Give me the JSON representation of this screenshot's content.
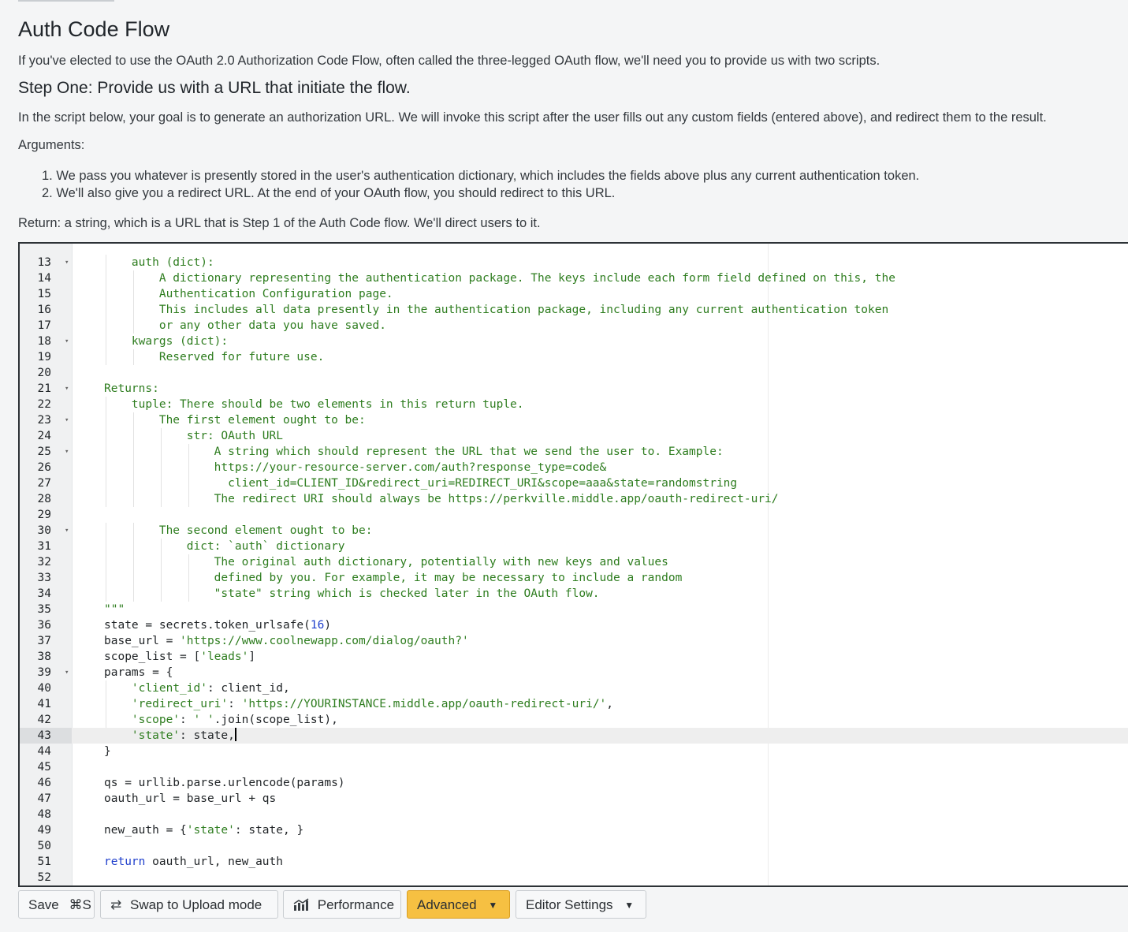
{
  "page": {
    "title": "Auth Code Flow",
    "intro": "If you've elected to use the OAuth 2.0 Authorization Code Flow, often called the three-legged OAuth flow, we'll need you to provide us with two scripts.",
    "step_heading": "Step One: Provide us with a URL that initiate the flow.",
    "step_desc": "In the script below, your goal is to generate an authorization URL. We will invoke this script after the user fills out any custom fields (entered above), and redirect them to the result.",
    "args_label": "Arguments:",
    "args": [
      "1. We pass you whatever is presently stored in the user's authentication dictionary, which includes the fields above plus any current authentication token.",
      "2. We'll also give you a redirect URL. At the end of your OAuth flow, you should redirect to this URL."
    ],
    "return_text": "Return: a string, which is a URL that is Step 1 of the Auth Code flow. We'll direct users to it."
  },
  "editor": {
    "lines": [
      {
        "n": "13",
        "fold": true,
        "text": "    auth (dict):",
        "kind": "doc"
      },
      {
        "n": "14",
        "fold": false,
        "text": "        A dictionary representing the authentication package. The keys include each form field defined on this, the",
        "kind": "doc"
      },
      {
        "n": "15",
        "fold": false,
        "text": "        Authentication Configuration page.",
        "kind": "doc"
      },
      {
        "n": "16",
        "fold": false,
        "text": "        This includes all data presently in the authentication package, including any current authentication token",
        "kind": "doc"
      },
      {
        "n": "17",
        "fold": false,
        "text": "        or any other data you have saved.",
        "kind": "doc"
      },
      {
        "n": "18",
        "fold": true,
        "text": "    kwargs (dict):",
        "kind": "doc"
      },
      {
        "n": "19",
        "fold": false,
        "text": "        Reserved for future use.",
        "kind": "doc"
      },
      {
        "n": "20",
        "fold": false,
        "text": "",
        "kind": "doc"
      },
      {
        "n": "21",
        "fold": true,
        "text": "Returns:",
        "kind": "doc"
      },
      {
        "n": "22",
        "fold": false,
        "text": "    tuple: There should be two elements in this return tuple.",
        "kind": "doc"
      },
      {
        "n": "23",
        "fold": true,
        "text": "        The first element ought to be:",
        "kind": "doc"
      },
      {
        "n": "24",
        "fold": false,
        "text": "            str: OAuth URL",
        "kind": "doc"
      },
      {
        "n": "25",
        "fold": true,
        "text": "                A string which should represent the URL that we send the user to. Example:",
        "kind": "doc"
      },
      {
        "n": "26",
        "fold": false,
        "text": "                https://your-resource-server.com/auth?response_type=code&",
        "kind": "doc"
      },
      {
        "n": "27",
        "fold": false,
        "text": "                  client_id=CLIENT_ID&redirect_uri=REDIRECT_URI&scope=aaa&state=randomstring",
        "kind": "doc"
      },
      {
        "n": "28",
        "fold": false,
        "text": "                The redirect URI should always be https://perkville.middle.app/oauth-redirect-uri/",
        "kind": "doc"
      },
      {
        "n": "29",
        "fold": false,
        "text": "",
        "kind": "doc"
      },
      {
        "n": "30",
        "fold": true,
        "text": "        The second element ought to be:",
        "kind": "doc"
      },
      {
        "n": "31",
        "fold": false,
        "text": "            dict: `auth` dictionary",
        "kind": "doc"
      },
      {
        "n": "32",
        "fold": false,
        "text": "                The original auth dictionary, potentially with new keys and values",
        "kind": "doc"
      },
      {
        "n": "33",
        "fold": false,
        "text": "                defined by you. For example, it may be necessary to include a random",
        "kind": "doc"
      },
      {
        "n": "34",
        "fold": false,
        "text": "                \"state\" string which is checked later in the OAuth flow.",
        "kind": "doc"
      },
      {
        "n": "35",
        "fold": false,
        "text": "\"\"\"",
        "kind": "doc"
      },
      {
        "n": "36",
        "fold": false,
        "text": "state = secrets.token_urlsafe(16)",
        "kind": "code"
      },
      {
        "n": "37",
        "fold": false,
        "text": "base_url = 'https://www.coolnewapp.com/dialog/oauth?'",
        "kind": "code"
      },
      {
        "n": "38",
        "fold": false,
        "text": "scope_list = ['leads']",
        "kind": "code"
      },
      {
        "n": "39",
        "fold": true,
        "text": "params = {",
        "kind": "code"
      },
      {
        "n": "40",
        "fold": false,
        "text": "    'client_id': client_id,",
        "kind": "code"
      },
      {
        "n": "41",
        "fold": false,
        "text": "    'redirect_uri': 'https://YOURINSTANCE.middle.app/oauth-redirect-uri/',",
        "kind": "code"
      },
      {
        "n": "42",
        "fold": false,
        "text": "    'scope': ' '.join(scope_list),",
        "kind": "code"
      },
      {
        "n": "43",
        "fold": false,
        "text": "    'state': state,",
        "kind": "code",
        "active": true
      },
      {
        "n": "44",
        "fold": false,
        "text": "}",
        "kind": "code"
      },
      {
        "n": "45",
        "fold": false,
        "text": "",
        "kind": "code"
      },
      {
        "n": "46",
        "fold": false,
        "text": "qs = urllib.parse.urlencode(params)",
        "kind": "code"
      },
      {
        "n": "47",
        "fold": false,
        "text": "oauth_url = base_url + qs",
        "kind": "code"
      },
      {
        "n": "48",
        "fold": false,
        "text": "",
        "kind": "code"
      },
      {
        "n": "49",
        "fold": false,
        "text": "new_auth = {'state': state, }",
        "kind": "code"
      },
      {
        "n": "50",
        "fold": false,
        "text": "",
        "kind": "code"
      },
      {
        "n": "51",
        "fold": false,
        "text": "return oauth_url, new_auth",
        "kind": "code"
      },
      {
        "n": "52",
        "fold": false,
        "text": "",
        "kind": "code"
      }
    ]
  },
  "toolbar": {
    "save_label": "Save",
    "save_shortcut": "⌘S",
    "swap_label": "Swap to Upload mode",
    "performance_label": "Performance",
    "advanced_label": "Advanced",
    "editor_settings_label": "Editor Settings",
    "accent_color": "#f6c042"
  }
}
